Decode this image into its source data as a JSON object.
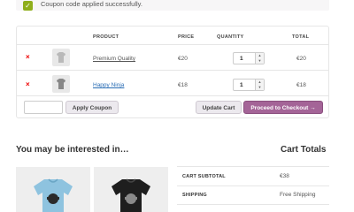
{
  "notice": {
    "message": "Coupon code applied successfully."
  },
  "cart": {
    "headers": {
      "product": "PRODUCT",
      "price": "PRICE",
      "quantity": "QUANTITY",
      "total": "TOTAL"
    },
    "items": [
      {
        "remove": "×",
        "name": "Premium Quality",
        "price": "€20",
        "quantity": "1",
        "total": "€20"
      },
      {
        "remove": "×",
        "name": "Happy Ninja",
        "price": "€18",
        "quantity": "1",
        "total": "€18"
      }
    ],
    "coupon_placeholder": "",
    "apply_coupon_label": "Apply Coupon",
    "update_cart_label": "Update Cart",
    "checkout_label": "Proceed to Checkout →"
  },
  "upsell": {
    "title": "You may be interested in…"
  },
  "totals": {
    "title": "Cart Totals",
    "rows": [
      {
        "label": "CART SUBTOTAL",
        "value": "€38"
      },
      {
        "label": "SHIPPING",
        "value": "Free Shipping"
      }
    ]
  },
  "colors": {
    "accent": "#a46497",
    "success": "#8fae1b",
    "remove": "#e00000"
  }
}
